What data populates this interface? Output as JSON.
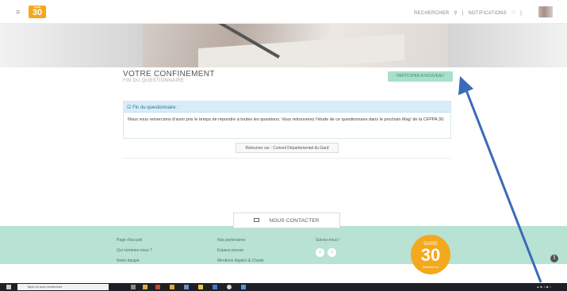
{
  "topbar": {
    "logo_text": "30",
    "logo_top": "GARD",
    "search_label": "RECHERCHER",
    "separator": "|",
    "notifications_label": "NOTIFICATIONS"
  },
  "page": {
    "title": "VOTRE CONFINEMENT",
    "subtitle": "FIN DU QUESTIONNAIRE",
    "share_label": "PARTICIPER A NOUVEAU"
  },
  "alert": {
    "heading": "Fin du questionnaire :",
    "body": "Nous vous remercions d'avoir pris le temps de répondre à toutes les questions. Vous retrouverez l'étude de ce questionnaire dans le prochain Mag' de la CFPPA 30."
  },
  "back_button": "Retourner sur : Conseil Départemental du Gard",
  "contact_label": "NOUS CONTACTER",
  "footer": {
    "col1": [
      "Page d'accueil",
      "Qui sommes-nous ?",
      "Notre équipe"
    ],
    "col2": [
      "Nos partenaires",
      "Espace presse",
      "Mentions légales & Charte"
    ],
    "col3_title": "Suivez-nous !",
    "social": [
      "f",
      "t"
    ],
    "big_logo": {
      "top": "GARD",
      "number": "30",
      "bottom": "Département"
    }
  },
  "taskbar": {
    "search_placeholder": "Taper ici pour rechercher"
  },
  "colors": {
    "accent_orange": "#f4a81d",
    "footer_mint": "#b7e2d4",
    "alert_blue": "#d8edf7",
    "share_green": "#a9e0cb",
    "annotation_arrow": "#3a6bb8"
  }
}
